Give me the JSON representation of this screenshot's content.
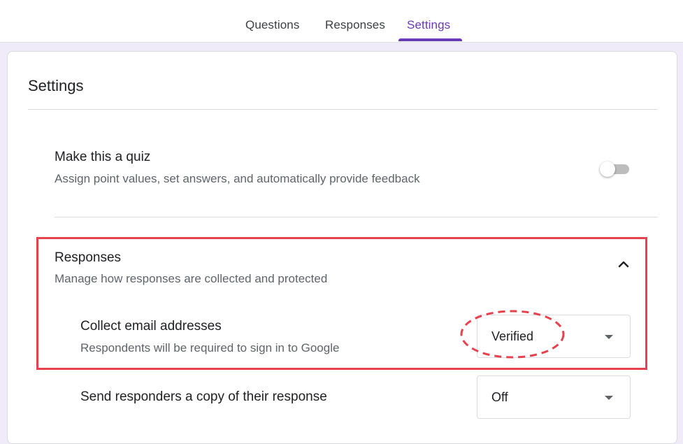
{
  "tabs": {
    "questions": "Questions",
    "responses": "Responses",
    "settings": "Settings",
    "active": "settings"
  },
  "settings": {
    "title": "Settings",
    "quiz": {
      "title": "Make this a quiz",
      "description": "Assign point values, set answers, and automatically provide feedback",
      "toggle_on": false
    },
    "responses_section": {
      "title": "Responses",
      "description": "Manage how responses are collected and protected",
      "expanded": true,
      "collect_email": {
        "title": "Collect email addresses",
        "description": "Respondents will be required to sign in to Google",
        "value": "Verified"
      },
      "send_copy": {
        "title": "Send responders a copy of their response",
        "value": "Off"
      }
    }
  },
  "colors": {
    "accent": "#673ab7",
    "highlight_box": "#e8414e",
    "background": "#f0ebf8"
  }
}
